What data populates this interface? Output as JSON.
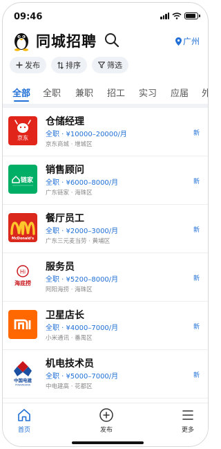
{
  "status": {
    "time": "09:46"
  },
  "header": {
    "title": "同城招聘",
    "city": "广州"
  },
  "filters": [
    {
      "label": "发布",
      "icon": "plus-icon"
    },
    {
      "label": "排序",
      "icon": "sort-icon"
    },
    {
      "label": "筛选",
      "icon": "filter-icon"
    }
  ],
  "tabs": [
    "全部",
    "全职",
    "兼职",
    "招工",
    "实习",
    "应届",
    "外"
  ],
  "jobs": [
    {
      "title": "仓储经理",
      "salary": "全职 · ¥10000–20000/月",
      "company": "京东商城 · 增城区",
      "badge": "新",
      "logo": "京东"
    },
    {
      "title": "销售顾问",
      "salary": "全职 · ¥6000–8000/月",
      "company": "广东链家 · 海珠区",
      "badge": "新",
      "logo": "链家"
    },
    {
      "title": "餐厅员工",
      "salary": "全职 · ¥2000–3000/月",
      "company": "广东三元麦当劳 · 黄埔区",
      "badge": "新",
      "logo": "McDonald's"
    },
    {
      "title": "服务员",
      "salary": "全职 · ¥5200–8000/月",
      "company": "阿阳海捞 · 海珠区",
      "badge": "新",
      "logo": "海底捞"
    },
    {
      "title": "卫星店长",
      "salary": "全职 · ¥4000–7000/月",
      "company": "小米通讯 · 番禺区",
      "badge": "新",
      "logo": "mi"
    },
    {
      "title": "机电技术员",
      "salary": "全职 · ¥5000–7000/月",
      "company": "中电建高 · 花都区",
      "badge": "新",
      "logo": "中国电建"
    }
  ],
  "bottom_nav": [
    {
      "label": "首页",
      "icon": "home-icon"
    },
    {
      "label": "发布",
      "icon": "plus-circle-icon"
    },
    {
      "label": "更多",
      "icon": "menu-icon"
    }
  ],
  "colors": {
    "accent": "#1f6fd6",
    "jd": "#e1251b",
    "lianjia": "#00ae66",
    "mcd": "#da291c",
    "haidilao": "#c8161d",
    "xiaomi": "#ff6700",
    "powerchina": "#1b4fa0"
  }
}
